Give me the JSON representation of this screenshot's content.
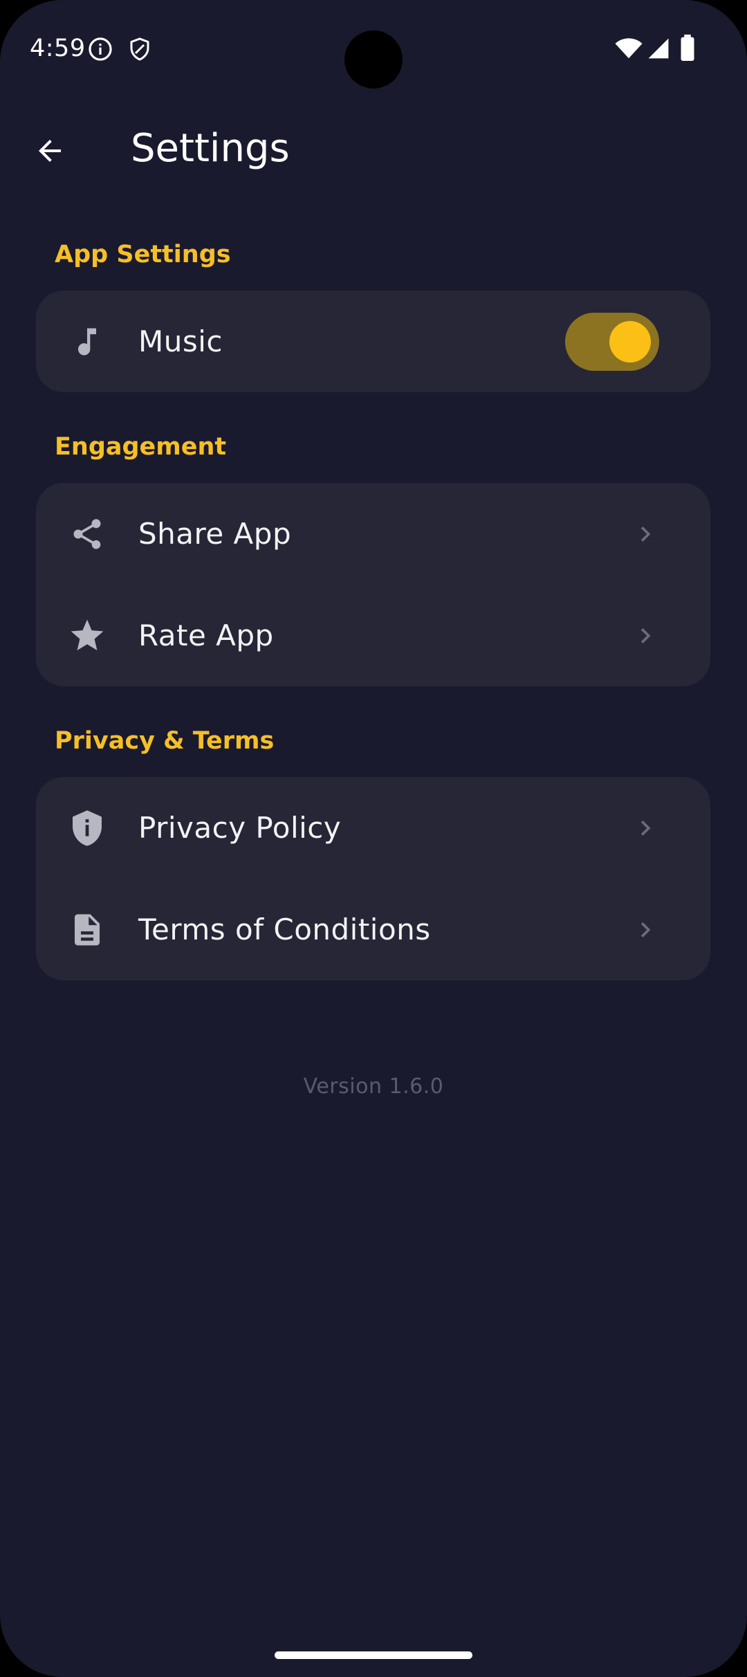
{
  "status_bar": {
    "time": "4:59",
    "icons": [
      "info-icon",
      "shield-icon",
      "wifi-icon",
      "signal-icon",
      "battery-icon"
    ]
  },
  "app_bar": {
    "back_icon": "arrow-left-icon",
    "title": "Settings"
  },
  "sections": {
    "app_settings": {
      "title": "App Settings",
      "music": {
        "icon": "music-note-icon",
        "label": "Music",
        "toggle_on": true
      }
    },
    "engagement": {
      "title": "Engagement",
      "share": {
        "icon": "share-icon",
        "label": "Share App"
      },
      "rate": {
        "icon": "star-icon",
        "label": "Rate App"
      }
    },
    "privacy": {
      "title": "Privacy & Terms",
      "policy": {
        "icon": "shield-info-icon",
        "label": "Privacy Policy"
      },
      "terms": {
        "icon": "document-icon",
        "label": "Terms of Conditions"
      }
    }
  },
  "version": "Version 1.6.0",
  "colors": {
    "background": "#1a1a2e",
    "card": "#262637",
    "accent": "#f6bf26",
    "toggle_track": "#8c7322",
    "toggle_knob": "#fbbf16",
    "icon": "#b7b7c2",
    "chevron": "#6b6b7c",
    "version_text": "#5b5b6e"
  }
}
